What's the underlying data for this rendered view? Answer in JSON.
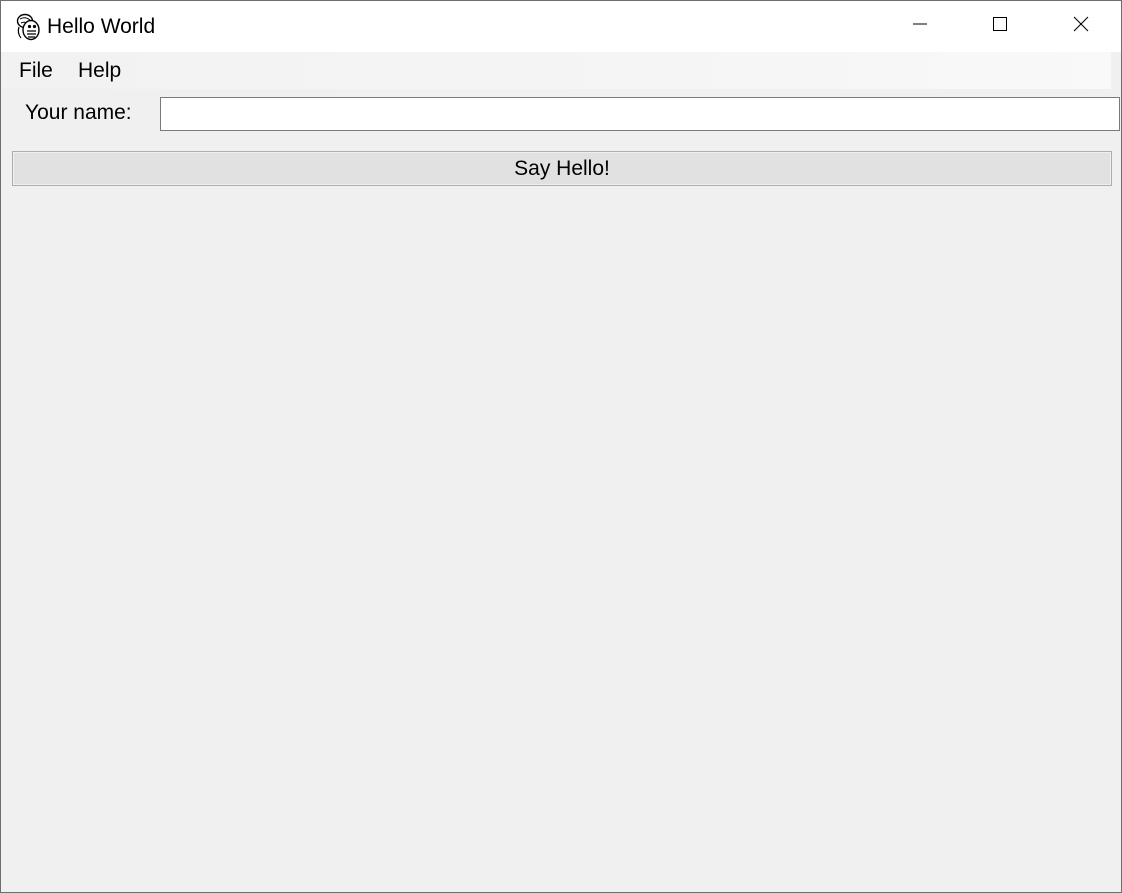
{
  "window": {
    "title": "Hello World",
    "icon": "python-feather-icon"
  },
  "title_controls": {
    "minimize_icon": "minimize-icon",
    "maximize_icon": "maximize-icon",
    "close_icon": "close-icon"
  },
  "menubar": {
    "items": [
      {
        "label": "File"
      },
      {
        "label": "Help"
      }
    ]
  },
  "form": {
    "name_label": "Your name:",
    "name_value": "",
    "name_placeholder": "",
    "submit_label": "Say Hello!"
  },
  "colors": {
    "window_bg": "#f0f0f0",
    "titlebar_bg": "#ffffff",
    "button_bg": "#e1e1e1",
    "input_border": "#7a7a7a"
  }
}
